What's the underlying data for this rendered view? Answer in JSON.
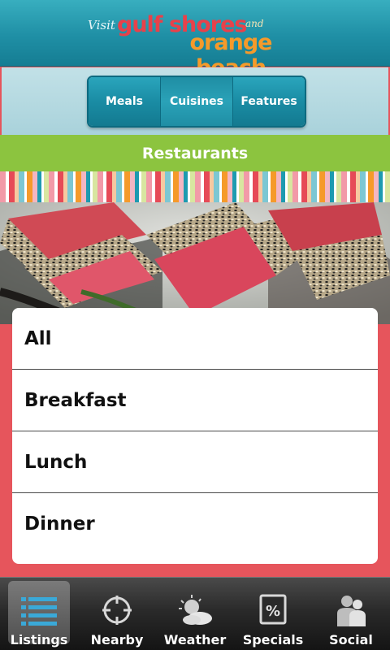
{
  "header": {
    "logo_visit": "Visit",
    "logo_gulf_shores": "gulf shores",
    "logo_and": "and",
    "logo_orange_beach": "orange beach"
  },
  "tabs": [
    {
      "label": "Meals",
      "active": false
    },
    {
      "label": "Cuisines",
      "active": true
    },
    {
      "label": "Features",
      "active": false
    }
  ],
  "title": "Restaurants",
  "list": {
    "items": [
      {
        "label": "All"
      },
      {
        "label": "Breakfast"
      },
      {
        "label": "Lunch"
      },
      {
        "label": "Dinner"
      }
    ]
  },
  "bottom_nav": [
    {
      "label": "Listings",
      "icon": "list-icon",
      "active": true
    },
    {
      "label": "Nearby",
      "icon": "crosshair-icon",
      "active": false
    },
    {
      "label": "Weather",
      "icon": "weather-icon",
      "active": false
    },
    {
      "label": "Specials",
      "icon": "percent-icon",
      "active": false
    },
    {
      "label": "Social",
      "icon": "people-icon",
      "active": false
    }
  ],
  "colors": {
    "header_teal": "#1f8fa5",
    "title_green": "#8cc43f",
    "background_red": "#e6555c",
    "tab_teal": "#1a8ca4"
  }
}
